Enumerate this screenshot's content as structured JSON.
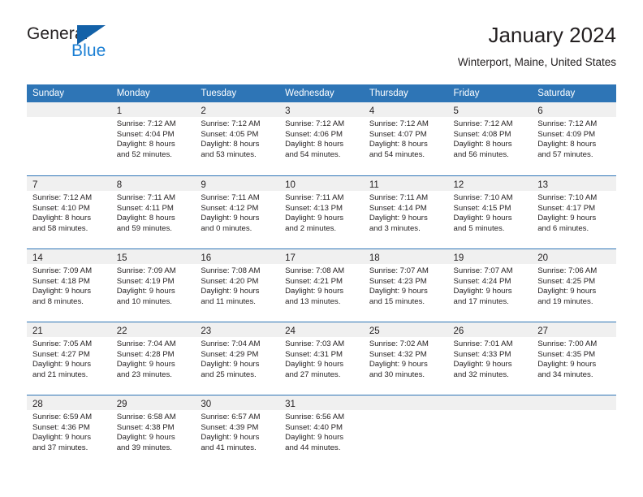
{
  "brand": {
    "name_top": "General",
    "name_bottom": "Blue"
  },
  "header": {
    "title": "January 2024",
    "location": "Winterport, Maine, United States"
  },
  "colors": {
    "header_blue": "#2e75b6",
    "brand_blue": "#1b7fd4",
    "triangle_blue": "#1361a8",
    "daynum_band": "#f0f0f0",
    "text": "#231f20"
  },
  "calendar": {
    "weekday_headers": [
      "Sunday",
      "Monday",
      "Tuesday",
      "Wednesday",
      "Thursday",
      "Friday",
      "Saturday"
    ],
    "weeks": [
      [
        {
          "day": "",
          "lines": []
        },
        {
          "day": "1",
          "lines": [
            "Sunrise: 7:12 AM",
            "Sunset: 4:04 PM",
            "Daylight: 8 hours",
            "and 52 minutes."
          ]
        },
        {
          "day": "2",
          "lines": [
            "Sunrise: 7:12 AM",
            "Sunset: 4:05 PM",
            "Daylight: 8 hours",
            "and 53 minutes."
          ]
        },
        {
          "day": "3",
          "lines": [
            "Sunrise: 7:12 AM",
            "Sunset: 4:06 PM",
            "Daylight: 8 hours",
            "and 54 minutes."
          ]
        },
        {
          "day": "4",
          "lines": [
            "Sunrise: 7:12 AM",
            "Sunset: 4:07 PM",
            "Daylight: 8 hours",
            "and 54 minutes."
          ]
        },
        {
          "day": "5",
          "lines": [
            "Sunrise: 7:12 AM",
            "Sunset: 4:08 PM",
            "Daylight: 8 hours",
            "and 56 minutes."
          ]
        },
        {
          "day": "6",
          "lines": [
            "Sunrise: 7:12 AM",
            "Sunset: 4:09 PM",
            "Daylight: 8 hours",
            "and 57 minutes."
          ]
        }
      ],
      [
        {
          "day": "7",
          "lines": [
            "Sunrise: 7:12 AM",
            "Sunset: 4:10 PM",
            "Daylight: 8 hours",
            "and 58 minutes."
          ]
        },
        {
          "day": "8",
          "lines": [
            "Sunrise: 7:11 AM",
            "Sunset: 4:11 PM",
            "Daylight: 8 hours",
            "and 59 minutes."
          ]
        },
        {
          "day": "9",
          "lines": [
            "Sunrise: 7:11 AM",
            "Sunset: 4:12 PM",
            "Daylight: 9 hours",
            "and 0 minutes."
          ]
        },
        {
          "day": "10",
          "lines": [
            "Sunrise: 7:11 AM",
            "Sunset: 4:13 PM",
            "Daylight: 9 hours",
            "and 2 minutes."
          ]
        },
        {
          "day": "11",
          "lines": [
            "Sunrise: 7:11 AM",
            "Sunset: 4:14 PM",
            "Daylight: 9 hours",
            "and 3 minutes."
          ]
        },
        {
          "day": "12",
          "lines": [
            "Sunrise: 7:10 AM",
            "Sunset: 4:15 PM",
            "Daylight: 9 hours",
            "and 5 minutes."
          ]
        },
        {
          "day": "13",
          "lines": [
            "Sunrise: 7:10 AM",
            "Sunset: 4:17 PM",
            "Daylight: 9 hours",
            "and 6 minutes."
          ]
        }
      ],
      [
        {
          "day": "14",
          "lines": [
            "Sunrise: 7:09 AM",
            "Sunset: 4:18 PM",
            "Daylight: 9 hours",
            "and 8 minutes."
          ]
        },
        {
          "day": "15",
          "lines": [
            "Sunrise: 7:09 AM",
            "Sunset: 4:19 PM",
            "Daylight: 9 hours",
            "and 10 minutes."
          ]
        },
        {
          "day": "16",
          "lines": [
            "Sunrise: 7:08 AM",
            "Sunset: 4:20 PM",
            "Daylight: 9 hours",
            "and 11 minutes."
          ]
        },
        {
          "day": "17",
          "lines": [
            "Sunrise: 7:08 AM",
            "Sunset: 4:21 PM",
            "Daylight: 9 hours",
            "and 13 minutes."
          ]
        },
        {
          "day": "18",
          "lines": [
            "Sunrise: 7:07 AM",
            "Sunset: 4:23 PM",
            "Daylight: 9 hours",
            "and 15 minutes."
          ]
        },
        {
          "day": "19",
          "lines": [
            "Sunrise: 7:07 AM",
            "Sunset: 4:24 PM",
            "Daylight: 9 hours",
            "and 17 minutes."
          ]
        },
        {
          "day": "20",
          "lines": [
            "Sunrise: 7:06 AM",
            "Sunset: 4:25 PM",
            "Daylight: 9 hours",
            "and 19 minutes."
          ]
        }
      ],
      [
        {
          "day": "21",
          "lines": [
            "Sunrise: 7:05 AM",
            "Sunset: 4:27 PM",
            "Daylight: 9 hours",
            "and 21 minutes."
          ]
        },
        {
          "day": "22",
          "lines": [
            "Sunrise: 7:04 AM",
            "Sunset: 4:28 PM",
            "Daylight: 9 hours",
            "and 23 minutes."
          ]
        },
        {
          "day": "23",
          "lines": [
            "Sunrise: 7:04 AM",
            "Sunset: 4:29 PM",
            "Daylight: 9 hours",
            "and 25 minutes."
          ]
        },
        {
          "day": "24",
          "lines": [
            "Sunrise: 7:03 AM",
            "Sunset: 4:31 PM",
            "Daylight: 9 hours",
            "and 27 minutes."
          ]
        },
        {
          "day": "25",
          "lines": [
            "Sunrise: 7:02 AM",
            "Sunset: 4:32 PM",
            "Daylight: 9 hours",
            "and 30 minutes."
          ]
        },
        {
          "day": "26",
          "lines": [
            "Sunrise: 7:01 AM",
            "Sunset: 4:33 PM",
            "Daylight: 9 hours",
            "and 32 minutes."
          ]
        },
        {
          "day": "27",
          "lines": [
            "Sunrise: 7:00 AM",
            "Sunset: 4:35 PM",
            "Daylight: 9 hours",
            "and 34 minutes."
          ]
        }
      ],
      [
        {
          "day": "28",
          "lines": [
            "Sunrise: 6:59 AM",
            "Sunset: 4:36 PM",
            "Daylight: 9 hours",
            "and 37 minutes."
          ]
        },
        {
          "day": "29",
          "lines": [
            "Sunrise: 6:58 AM",
            "Sunset: 4:38 PM",
            "Daylight: 9 hours",
            "and 39 minutes."
          ]
        },
        {
          "day": "30",
          "lines": [
            "Sunrise: 6:57 AM",
            "Sunset: 4:39 PM",
            "Daylight: 9 hours",
            "and 41 minutes."
          ]
        },
        {
          "day": "31",
          "lines": [
            "Sunrise: 6:56 AM",
            "Sunset: 4:40 PM",
            "Daylight: 9 hours",
            "and 44 minutes."
          ]
        },
        {
          "day": "",
          "lines": []
        },
        {
          "day": "",
          "lines": []
        },
        {
          "day": "",
          "lines": []
        }
      ]
    ]
  }
}
